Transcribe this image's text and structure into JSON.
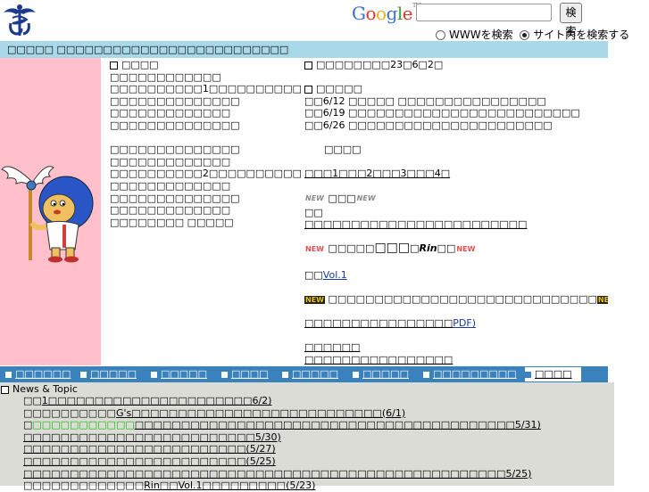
{
  "header": {
    "google_label": "Google",
    "search": {
      "value": "",
      "placeholder": ""
    },
    "search_button": "検索",
    "radio_www": "WWWを検索",
    "radio_site": "サイト内を検索する"
  },
  "title_bar": {
    "text": "□□□□□ □□□□□□□□□□□□□□□□□□□□□□□□□"
  },
  "col1": {
    "heading": "□□□□",
    "lines": [
      "□□□□□□□□□□□□",
      "□□□□□□□□□□1□□□□□□□□□□",
      "□□□□□□□□□□□□□□",
      "□□□□□□□□□□□□□",
      "□□□□□□□□□□□□□□",
      "",
      "□□□□□□□□□□□□□□",
      "□□□□□□□□□□□□□",
      "□□□□□□□□□□2□□□□□□□□□□",
      "□□□□□□□□□□□□□",
      "□□□□□□□□□□□□□□",
      "□□□□□□□□□□□□□",
      "□□□□□□□□ □□□□□"
    ]
  },
  "col2": {
    "date_heading": "□□□□□□□□23□6□2□",
    "schedule_heading": "□□□□□",
    "schedule": [
      "□□6/12 □□□□□ □□□□□□□□□□□□□□□□",
      "□□6/19 □□□□□□□□□□□□□□□□□□□□□□□□□",
      "□□6/26 □□□□□□□□□□□□□□□□□□□□□□"
    ],
    "indent_label": "□□□□",
    "links_row": "□□□1□□□2□□□3□□□4□",
    "new1_title": "□□□",
    "new_label": "NEW",
    "new1_sub": "□□",
    "new1_line": "□□□□□□□□□□□□□□□□□□□□□□□□",
    "rin_line_a": "□□□□□",
    "rin_big": "□□□",
    "rin_mid": "□",
    "rin_italic": "Rin",
    "rin_end": "□□",
    "vol_prefix": "□□",
    "vol_link": "Vol.1",
    "new2_text": "□□□□□□□□□□□□□□□□□□□□□□□□□□□□□",
    "pdf_prefix": "□□□□□□□□□□□□□□□□",
    "pdf_link": "PDF)",
    "link_a": "□□□□□□",
    "link_b": "□□□□□□□□□□□□□□□□"
  },
  "nav": {
    "items": [
      "□□□□□□",
      "□□□□□",
      "□□□□□",
      "□□□□",
      "□□□□□",
      "□□□□□",
      "□□□□□□□□□"
    ],
    "current": "□□□□"
  },
  "news": {
    "heading": "News & Topic",
    "items": [
      {
        "pre": "□□",
        "hl": "",
        "text": "1□□□□□□□□□□□□□□□□□□□□□□6/2)"
      },
      {
        "pre": "□□□□□□□□□□",
        "hl": "",
        "text": "G's□□□□□□□□□□□□□□□□□□□□□□□□□□□(6/1)"
      },
      {
        "pre": "□",
        "hl": "",
        "green": "□□□□□□□□□□□",
        "text": "□□□□□□□□□□□□□□□□□□□□□□□□□□□□□□□□□□□□□□□□□5/31)"
      },
      {
        "pre": "",
        "hl": "",
        "text": "□□□□□□□□□□□□□□□□□□□□□□□□□5/30)"
      },
      {
        "pre": "",
        "hl": "",
        "text": "□□□□□□□□□□□□□□□□□□□□□□□□(5/27)"
      },
      {
        "pre": "",
        "hl": "",
        "text": "□□□□□□□□□□□□□□□□□□□□□□□□(5/25)"
      },
      {
        "pre": "",
        "hl": "",
        "text": "□□□□□□□□□□□□□□□□□□□□□□□□□□□□□□□□□□□□□□□□□□□□□□□□□□□□5/25)"
      },
      {
        "pre": "□□□□□□□□□□□□□",
        "hl": "",
        "text": "Rin□□Vol.1□□□□□□□□□(5/23)"
      }
    ]
  }
}
